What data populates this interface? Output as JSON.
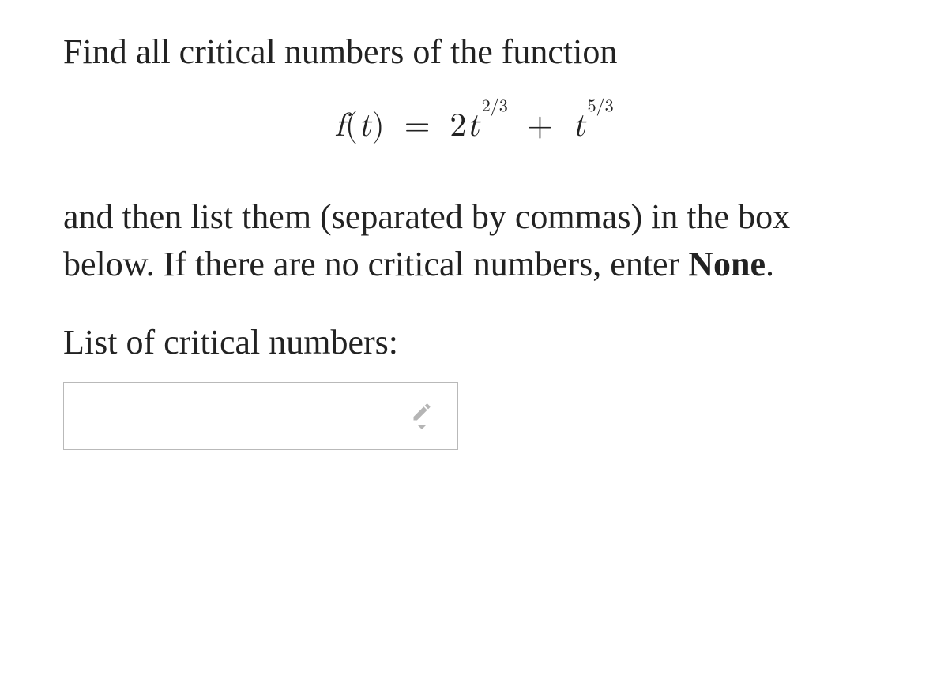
{
  "question": {
    "intro": "Find all critical numbers of the function",
    "formula": {
      "lhs_var": "f",
      "lhs_arg": "t",
      "eq": "=",
      "term1_coeff": "2",
      "term1_base": "t",
      "term1_exp": "2/3",
      "plus": "+",
      "term2_base": "t",
      "term2_exp": "5/3"
    },
    "body_part1": "and then list them (separated by commas) in the box below. If there are no critical numbers, enter ",
    "body_strong": "None",
    "body_part2": ".",
    "prompt": "List of critical numbers:"
  },
  "input": {
    "value": "",
    "placeholder": ""
  }
}
